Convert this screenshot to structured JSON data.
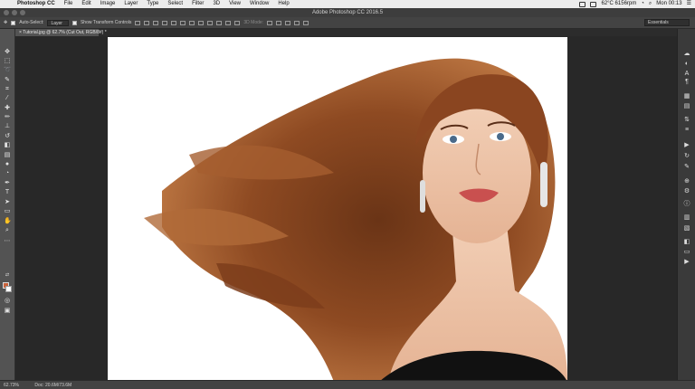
{
  "menubar": {
    "app": "Photoshop CC",
    "items": [
      "File",
      "Edit",
      "Image",
      "Layer",
      "Type",
      "Select",
      "Filter",
      "3D",
      "View",
      "Window",
      "Help"
    ],
    "battery": "62°C 6156rpm",
    "clock": "Mon 00:13"
  },
  "window": {
    "title": "Adobe Photoshop CC 2016.5"
  },
  "options": {
    "auto_select_label": "Auto-Select:",
    "auto_select_value": "Layer",
    "transform_label": "Show Transform Controls",
    "mode_3d_label": "3D Mode:",
    "workspace": "Essentials"
  },
  "document": {
    "tab_label": "Tutorial.jpg @ 62.7% (Cut Out, RGB/8#) *"
  },
  "status": {
    "zoom": "62.73%",
    "doc_size": "Doc: 20.6M/73.6M"
  },
  "colors": {
    "foreground": "#c9623b",
    "background": "#ffffff"
  },
  "toolbar_icons": [
    "move-icon",
    "marquee-icon",
    "lasso-icon",
    "quick-select-icon",
    "crop-icon",
    "eyedropper-icon",
    "healing-icon",
    "brush-icon",
    "clone-stamp-icon",
    "history-brush-icon",
    "eraser-icon",
    "gradient-icon",
    "blur-icon",
    "dodge-icon",
    "pen-icon",
    "type-icon",
    "path-select-icon",
    "rectangle-icon",
    "hand-icon",
    "zoom-icon",
    "more-tools-icon"
  ],
  "panel_icons": [
    "libraries-icon",
    "adjust-icon",
    "character-icon",
    "paragraph-icon",
    "layers-icon",
    "channels-icon",
    "paths-icon",
    "properties-icon",
    "play-icon",
    "history-icon",
    "brush-presets-icon",
    "clone-source-icon",
    "tool-presets-icon",
    "info-icon",
    "swatches-icon",
    "styles-icon",
    "notes-icon",
    "timeline-icon",
    "measurement-icon"
  ]
}
